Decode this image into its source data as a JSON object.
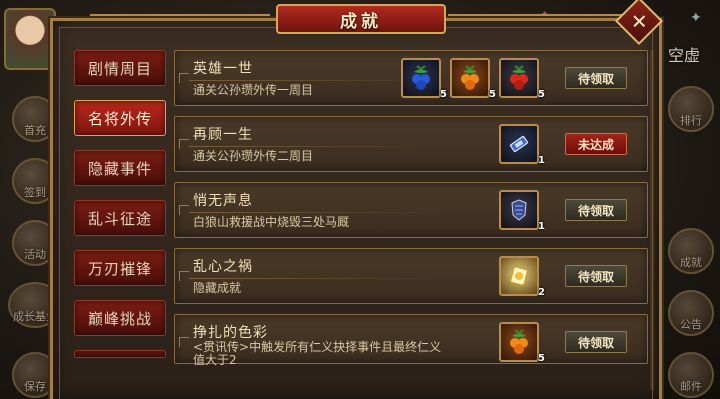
{
  "window": {
    "title": "成就",
    "close_label": "✕"
  },
  "background_hud": {
    "left_buttons": [
      "首充",
      "签到",
      "活动",
      "成长基金",
      "保存"
    ],
    "right_buttons": [
      "排行",
      "成就",
      "公告",
      "邮件"
    ],
    "top_right_text": "空虚"
  },
  "tabs": [
    {
      "label": "剧情周目",
      "active": false
    },
    {
      "label": "名将外传",
      "active": true
    },
    {
      "label": "隐藏事件",
      "active": false
    },
    {
      "label": "乱斗征途",
      "active": false
    },
    {
      "label": "万刃摧锋",
      "active": false
    },
    {
      "label": "巅峰挑战",
      "active": false
    }
  ],
  "achievements": [
    {
      "title": "英雄一世",
      "desc": "通关公孙瓒外传一周目",
      "status": "待领取",
      "status_type": "claim",
      "rewards": [
        {
          "icon": "blue-berry-icon",
          "count": "5"
        },
        {
          "icon": "orange-berry-icon",
          "count": "5"
        },
        {
          "icon": "red-berry-icon",
          "count": "5"
        }
      ]
    },
    {
      "title": "再顾一生",
      "desc": "通关公孙瓒外传二周目",
      "status": "未达成",
      "status_type": "incomplete",
      "rewards": [
        {
          "icon": "scroll-item-icon",
          "count": "1"
        }
      ]
    },
    {
      "title": "悄无声息",
      "desc": "白狼山救援战中烧毁三处马厩",
      "status": "待领取",
      "status_type": "claim",
      "rewards": [
        {
          "icon": "armor-item-icon",
          "count": "1"
        }
      ]
    },
    {
      "title": "乱心之祸",
      "desc": "隐藏成就",
      "status": "待领取",
      "status_type": "claim",
      "rewards": [
        {
          "icon": "gold-token-icon",
          "count": "2"
        }
      ]
    },
    {
      "title": "挣扎的色彩",
      "desc": "<贯讯传>中触发所有仁义抉择事件且最终仁义值大于2",
      "status": "待领取",
      "status_type": "claim",
      "rewards": [
        {
          "icon": "orange-berry-icon",
          "count": "5"
        }
      ]
    }
  ],
  "colors": {
    "panel_border": "#a47d45",
    "tab_active": "#b7281b",
    "status_incomplete": "#a42216"
  }
}
